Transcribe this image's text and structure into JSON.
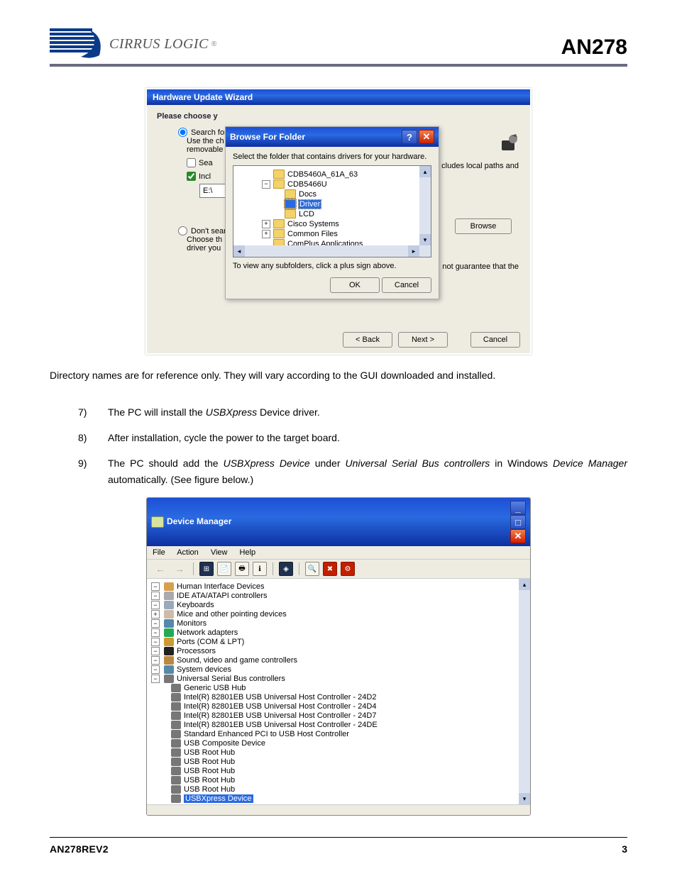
{
  "header": {
    "brand": "CIRRUS LOGIC",
    "doc_id": "AN278"
  },
  "wizard": {
    "title": "Hardware Update Wizard",
    "please": "Please choose y",
    "radio1": "Search for",
    "radio1_sub1": "Use the ch",
    "radio1_sub2": "removable",
    "chk_sea": "Sea",
    "chk_incl": "Incl",
    "input_prefix": "E:\\",
    "browse_btn": "Browse",
    "radio2": "Don't sear",
    "radio2_sub1": "Choose th",
    "radio2_sub2": "driver you",
    "right1": "cludes local paths and",
    "right2": "not guarantee that the",
    "back": "< Back",
    "next": "Next >",
    "cancel": "Cancel"
  },
  "browse": {
    "title": "Browse For Folder",
    "instr": "Select the folder that contains drivers for your hardware.",
    "items": [
      "CDB5460A_61A_63",
      "CDB5466U",
      "Docs",
      "Driver",
      "LCD",
      "Cisco Systems",
      "Common Files",
      "ComPlus Applications"
    ],
    "sub_note": "To view any subfolders, click a plus sign above.",
    "ok": "OK",
    "cancel": "Cancel"
  },
  "note": "Directory names are for reference only. They will vary according to the GUI downloaded and installed.",
  "steps": {
    "7": {
      "pre": "The PC will install the ",
      "em": "USBXpress",
      "post": " Device driver."
    },
    "8": "After installation, cycle the power to the target board.",
    "9": {
      "pre": "The PC should add the ",
      "em1": "USBXpress Device",
      "mid": " under ",
      "em2": "Universal Serial Bus controllers",
      "mid2": " in Windows ",
      "em3": "Device Manager",
      "post": " automatically. (See figure below.)"
    }
  },
  "devmgr": {
    "title": "Device Manager",
    "menu": [
      "File",
      "Action",
      "View",
      "Help"
    ],
    "tree": [
      "Human Interface Devices",
      "IDE ATA/ATAPI controllers",
      "Keyboards",
      "Mice and other pointing devices",
      "Monitors",
      "Network adapters",
      "Ports (COM & LPT)",
      "Processors",
      "Sound, video and game controllers",
      "System devices",
      "Universal Serial Bus controllers"
    ],
    "usb_children": [
      "Generic USB Hub",
      "Intel(R) 82801EB USB Universal Host Controller - 24D2",
      "Intel(R) 82801EB USB Universal Host Controller - 24D4",
      "Intel(R) 82801EB USB Universal Host Controller - 24D7",
      "Intel(R) 82801EB USB Universal Host Controller - 24DE",
      "Standard Enhanced PCI to USB Host Controller",
      "USB Composite Device",
      "USB Root Hub",
      "USB Root Hub",
      "USB Root Hub",
      "USB Root Hub",
      "USB Root Hub",
      "USBXpress Device"
    ]
  },
  "footer": {
    "rev": "AN278REV2",
    "page": "3"
  }
}
